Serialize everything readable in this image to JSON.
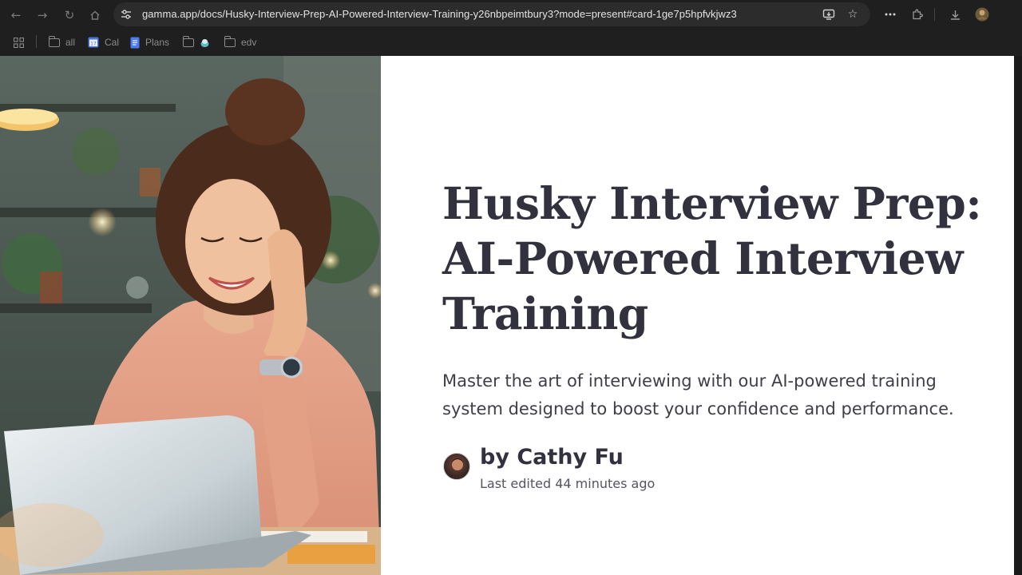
{
  "browser": {
    "url": "gamma.app/docs/Husky-Interview-Prep-AI-Powered-Interview-Training-y26nbpeimtbury3?mode=present#card-1ge7p5hpfvkjwz3",
    "bookmarks": [
      {
        "label": "all",
        "icon": "folder-icon"
      },
      {
        "label": "Cal",
        "icon": "calendar-icon"
      },
      {
        "label": "Plans",
        "icon": "docs-icon"
      },
      {
        "label": "",
        "icon": "folder-icon"
      },
      {
        "label": "edv",
        "icon": "folder-icon"
      }
    ]
  },
  "card": {
    "title": "Husky Interview Prep: AI-Powered Interview Training",
    "subtitle": "Master the art of interviewing with our AI-powered training system designed to boost your confidence and performance.",
    "author": "by Cathy Fu",
    "last_edited": "Last edited 44 minutes ago"
  },
  "colors": {
    "chrome_bg": "#1f1f1f",
    "omnibox_bg": "#2c2c2c",
    "title_text": "#32323e",
    "body_text": "#3f3f48"
  }
}
